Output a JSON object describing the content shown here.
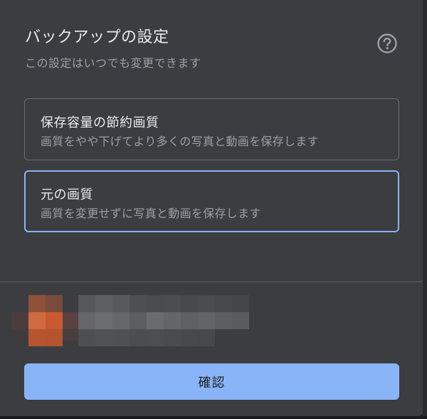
{
  "dialog": {
    "title": "バックアップの設定",
    "subtitle": "この設定はいつでも変更できます",
    "help_icon": "help-circle-icon"
  },
  "options": [
    {
      "title": "保存容量の節約画質",
      "description": "画質をやや下げてより多くの写真と動画を保存します",
      "selected": false
    },
    {
      "title": "元の画質",
      "description": "画質を変更せずに写真と動画を保存します",
      "selected": true
    }
  ],
  "account": {
    "avatar": "account-avatar"
  },
  "footer": {
    "confirm_label": "確認"
  },
  "colors": {
    "dialog_bg": "#3c3d40",
    "accent": "#8ab4f8",
    "text_primary": "#e8eaed",
    "text_secondary": "#9aa0a6"
  }
}
